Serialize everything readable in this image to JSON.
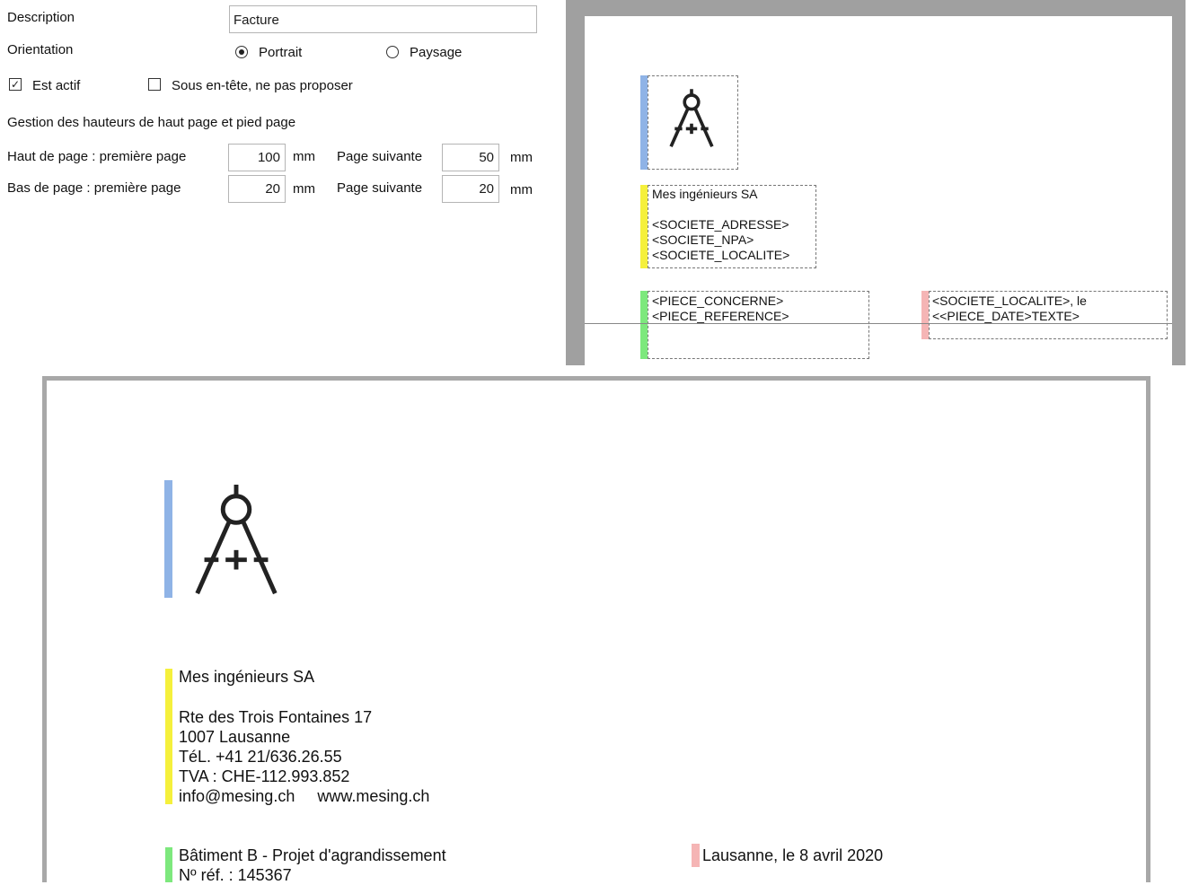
{
  "form": {
    "description_label": "Description",
    "description_value": "Facture",
    "orientation_label": "Orientation",
    "orientation_options": [
      "Portrait",
      "Paysage"
    ],
    "orientation_selected": "Portrait",
    "est_actif_label": "Est actif",
    "est_actif_checked": true,
    "sous_entete_label": "Sous en-tête, ne pas proposer",
    "sous_entete_checked": false,
    "section_title": "Gestion des hauteurs de haut page et pied page",
    "haut_label": "Haut de page : première page",
    "haut_first_value": "100",
    "haut_next_value": "50",
    "bas_label": "Bas de page  : première page",
    "bas_first_value": "20",
    "bas_next_value": "20",
    "unit": "mm",
    "page_suivante_label": "Page suivante"
  },
  "template_preview": {
    "company_block": "Mes ingénieurs SA\n\n<SOCIETE_ADRESSE>\n<SOCIETE_NPA>\n<SOCIETE_LOCALITE>",
    "piece_block": "<PIECE_CONCERNE>\n<PIECE_REFERENCE>",
    "date_block": "<SOCIETE_LOCALITE>, le\n<<PIECE_DATE>TEXTE>"
  },
  "rendered_page": {
    "company_name": "Mes ingénieurs SA",
    "address_lines": "Rte des Trois Fontaines 17\n1007 Lausanne\nTéL. +41 21/636.26.55\nTVA : CHE-112.993.852\ninfo@mesing.ch     www.mesing.ch",
    "piece_lines": "Bâtiment B - Projet d'agrandissement\nNº réf. : 145367",
    "date_line": "Lausanne, le 8 avril 2020"
  },
  "colors": {
    "logo_bar": "#8fb3e6",
    "company_bar": "#f5f03c",
    "piece_bar": "#7de87d",
    "date_bar": "#f5b5b5"
  },
  "icons": [
    "compass-logo-icon"
  ]
}
